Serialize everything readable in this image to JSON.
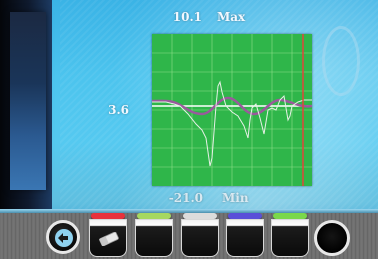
{
  "readouts": {
    "max_value": "10.1",
    "max_label": "Max",
    "mid_value": "3.6",
    "min_value": "-21.0",
    "min_label": "Min"
  },
  "graph": {
    "background_color": "#2fb64a",
    "grid_color": "#8fe08a",
    "baseline_color": "#ffffff",
    "trace_color": "#e6f0e6",
    "smooth_trace_color": "#9a5a9c",
    "cursor_color": "#e0463a"
  },
  "toolbar": {
    "slot_cap_colors": [
      "#e8323c",
      "#a6d860",
      "#dcdcdc",
      "#5a4fd8",
      "#7ad84a"
    ],
    "icons": [
      "back-arrow-icon",
      "eraser-icon",
      "round-button-icon"
    ]
  }
}
